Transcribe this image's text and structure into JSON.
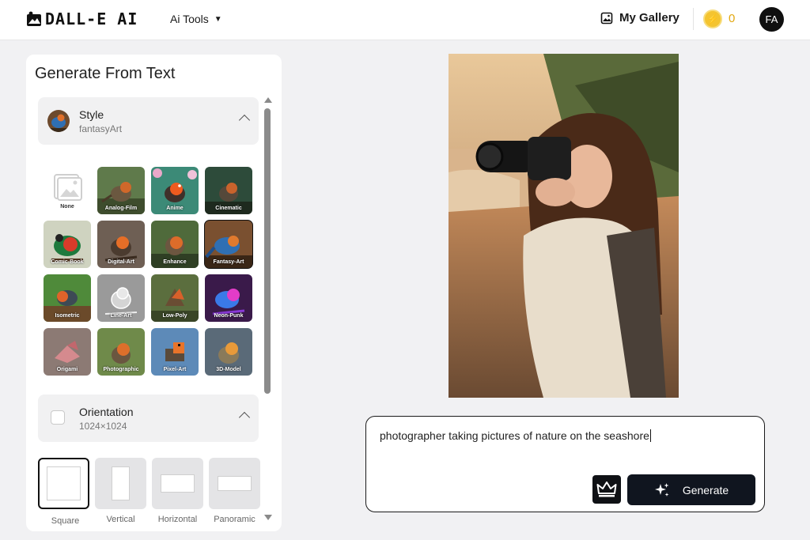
{
  "header": {
    "logo_text": "DALL-E AI",
    "tools_label": "Ai Tools",
    "gallery_label": "My Gallery",
    "credits": "0",
    "avatar_initials": "FA"
  },
  "panel": {
    "title": "Generate From Text",
    "style": {
      "title": "Style",
      "selected": "fantasyArt"
    },
    "styles": [
      {
        "label": "None",
        "selected": false
      },
      {
        "label": "Analog-Film",
        "selected": false
      },
      {
        "label": "Anime",
        "selected": false
      },
      {
        "label": "Cinematic",
        "selected": false
      },
      {
        "label": "Comic-Book",
        "selected": false
      },
      {
        "label": "Digital-Art",
        "selected": false
      },
      {
        "label": "Enhance",
        "selected": false
      },
      {
        "label": "Fantasy-Art",
        "selected": true
      },
      {
        "label": "Isometric",
        "selected": false
      },
      {
        "label": "Line-Art",
        "selected": false
      },
      {
        "label": "Low-Poly",
        "selected": false
      },
      {
        "label": "Neon-Punk",
        "selected": false
      },
      {
        "label": "Origami",
        "selected": false
      },
      {
        "label": "Photographic",
        "selected": false
      },
      {
        "label": "Pixel-Art",
        "selected": false
      },
      {
        "label": "3D-Model",
        "selected": false
      }
    ],
    "orientation": {
      "title": "Orientation",
      "selected": "1024×1024",
      "options": [
        "Square",
        "Vertical",
        "Horizontal",
        "Panoramic"
      ]
    }
  },
  "prompt": {
    "text": "photographer taking pictures of nature on the seashore",
    "generate_label": "Generate"
  },
  "colors": {
    "accent": "#10151f",
    "coin": "#f4c430",
    "credits": "#e2a812"
  }
}
